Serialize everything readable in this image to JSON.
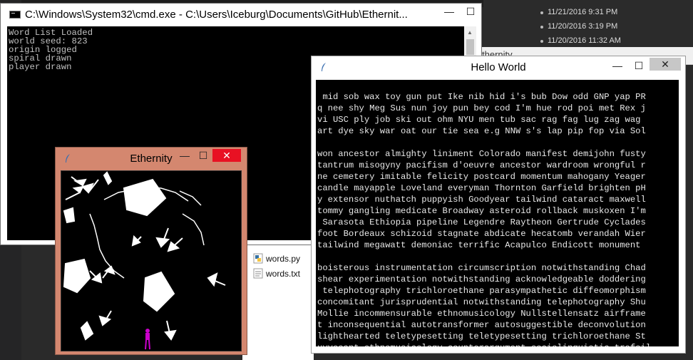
{
  "background": {
    "explorer_rows": [
      {
        "text": "11/21/2016 9:31 PM"
      },
      {
        "text": "11/20/2016 3:19 PM"
      },
      {
        "text": "11/20/2016 11:32 AM"
      }
    ],
    "files": [
      {
        "name": "words.py",
        "icon": "python-file-icon"
      },
      {
        "name": "words.txt",
        "icon": "text-file-icon"
      }
    ],
    "peek_title": "thernity"
  },
  "cmd_window": {
    "title": "C:\\Windows\\System32\\cmd.exe - C:\\Users\\Iceburg\\Documents\\GitHub\\Ethernit...",
    "output": [
      "Word List Loaded",
      "world seed: 823",
      "origin logged",
      "spiral drawn",
      "player drawn"
    ],
    "minimize_glyph": "—",
    "maximize_glyph": "☐"
  },
  "hello_window": {
    "title": "Hello World",
    "minimize_glyph": "—",
    "maximize_glyph": "☐",
    "close_glyph": "✕",
    "text_lines": [
      " mid sob wax toy gun put Ike nib hid i's bub Dow odd GNP yap PR",
      "q nee shy Meg Sus nun joy pun bey cod I'm hue rod poi met Rex j",
      "vi USC ply job ski out ohm NYU men tub sac rag fag lug zag wag ",
      "art dye sky war oat our tie sea e.g NNW s's lap pip fop via Sol",
      "",
      "won ancestor almighty liniment Colorado manifest demijohn fusty",
      "tantrum misogyny pacifism d'oeuvre ancestor wardroom wrongful r",
      "ne cemetery imitable felicity postcard momentum mahogany Yeager",
      "candle mayapple Loveland everyman Thornton Garfield brighten pH",
      "y extensor nuthatch puppyish Goodyear tailwind cataract maxwell",
      "tommy gangling medicate Broadway asteroid rollback muskoxen I'm",
      " Sarasota Ethiopia pipeline Legendre Raytheon Gertrude Cyclades",
      "foot Bordeaux schizoid stagnate abdicate hecatomb verandah Wier",
      "tailwind megawatt demoniac terrific Acapulco Endicott monument ",
      "",
      "boisterous instrumentation circumscription notwithstanding Chad",
      "shear experimentation notwithstanding acknowledgeable doddering",
      " telephotography trichloroethane parasympathetic diffeomorphism",
      "concomitant jurisprudential notwithstanding telephotography Shu",
      "Mollie incommensurable ethnomusicology Nullstellensatz airframe",
      "t inconsequential autotransformer autosuggestible deconvolution",
      "lighthearted teletypesetting teletypesetting trichloroethane St",
      "uyvesant ethnomusicology counterargument sociolinguistic trefoil"
    ]
  },
  "ethernity_window": {
    "title": "Ethernity",
    "minimize_glyph": "—",
    "maximize_glyph": "☐",
    "close_glyph": "✕",
    "player_color": "#cc00cc"
  }
}
